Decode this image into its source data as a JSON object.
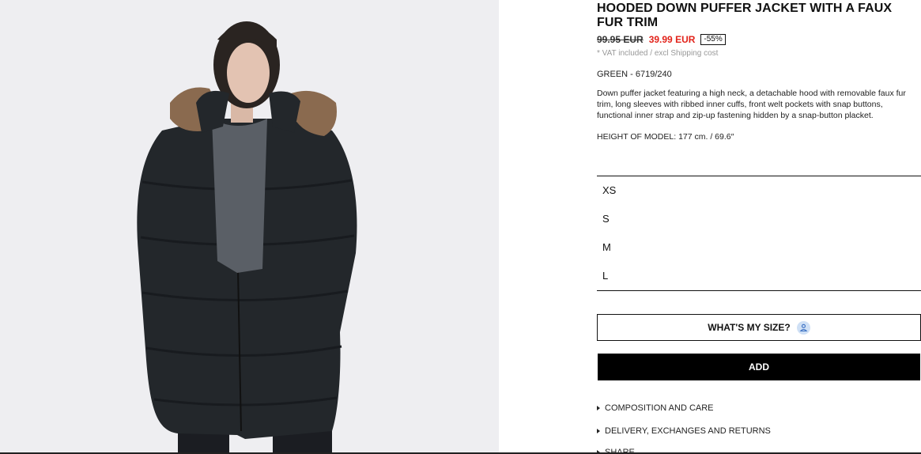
{
  "product": {
    "title": "HOODED DOWN PUFFER JACKET WITH A FAUX FUR TRIM",
    "old_price": "99.95 EUR",
    "new_price": "39.99 EUR",
    "discount": "-55%",
    "vat_note": "* VAT included / excl Shipping cost",
    "color_ref": "GREEN - 6719/240",
    "description": "Down puffer jacket featuring a high neck, a detachable hood with removable faux fur trim, long sleeves with ribbed inner cuffs, front welt pockets with snap buttons, functional inner strap and zip-up fastening hidden by a snap-button placket.",
    "model_height": "HEIGHT OF MODEL: 177 cm. / 69.6″"
  },
  "sizes": [
    "XS",
    "S",
    "M",
    "L"
  ],
  "actions": {
    "size_guide_label": "WHAT'S MY SIZE?",
    "add_label": "ADD"
  },
  "accordion": {
    "composition_label": "COMPOSITION AND CARE",
    "delivery_label": "DELIVERY, EXCHANGES AND RETURNS",
    "share_label": "SHARE"
  },
  "icons": {
    "size_guide": "person-icon",
    "accordion": "triangle-right-icon"
  },
  "colors": {
    "sale_red": "#e2231a",
    "add_bg": "#000000",
    "size_icon_bg": "#cfe0f5",
    "photo_bg": "#eeeef1"
  }
}
